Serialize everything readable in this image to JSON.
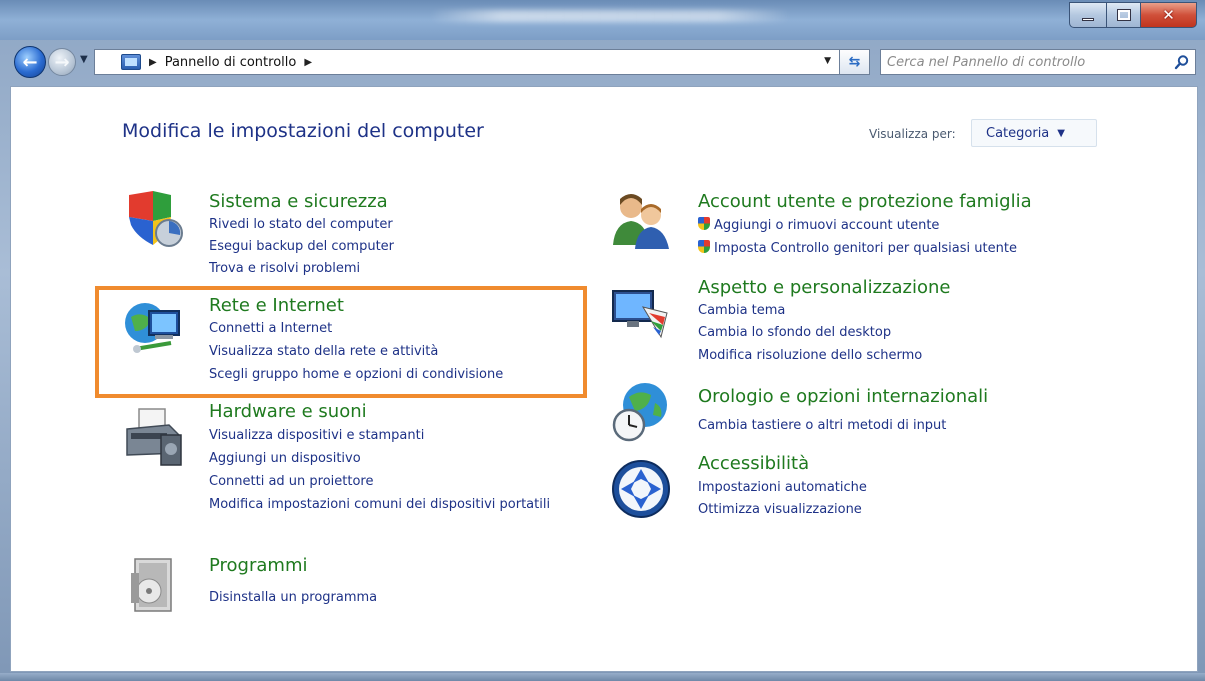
{
  "window": {
    "minimize_label": "minimize",
    "maximize_label": "maximize",
    "close_label": "close"
  },
  "nav": {
    "back_glyph": "←",
    "forward_glyph": "→",
    "breadcrumb": "Pannello di controllo",
    "search_placeholder": "Cerca nel Pannello di controllo"
  },
  "header": {
    "title": "Modifica le impostazioni del computer",
    "view_by_label": "Visualizza per:",
    "view_by_value": "Categoria"
  },
  "categories": [
    {
      "title": "Sistema e sicurezza",
      "icon": "shield-icon",
      "links": [
        "Rivedi lo stato del computer",
        "Esegui backup del computer",
        "Trova e risolvi problemi"
      ]
    },
    {
      "title": "Rete e Internet",
      "icon": "network-icon",
      "links": [
        "Connetti a Internet",
        "Visualizza stato della rete e attività",
        "Scegli gruppo home e opzioni di condivisione"
      ]
    },
    {
      "title": "Hardware e suoni",
      "icon": "printer-icon",
      "links": [
        "Visualizza dispositivi e stampanti",
        "Aggiungi un dispositivo",
        "Connetti ad un proiettore",
        "Modifica impostazioni comuni dei dispositivi portatili"
      ]
    },
    {
      "title": "Programmi",
      "icon": "programs-icon",
      "links": [
        "Disinstalla un programma"
      ]
    },
    {
      "title": "Account utente e protezione famiglia",
      "icon": "users-icon",
      "links": [
        "Aggiungi o rimuovi account utente",
        "Imposta Controllo genitori per qualsiasi utente"
      ]
    },
    {
      "title": "Aspetto e personalizzazione",
      "icon": "appearance-icon",
      "links": [
        "Cambia tema",
        "Cambia lo sfondo del desktop",
        "Modifica risoluzione dello schermo"
      ]
    },
    {
      "title": "Orologio e opzioni internazionali",
      "icon": "clock-globe-icon",
      "links": [
        "Cambia tastiere o altri metodi di input"
      ]
    },
    {
      "title": "Accessibilità",
      "icon": "accessibility-icon",
      "links": [
        "Impostazioni automatiche",
        "Ottimizza visualizzazione"
      ]
    }
  ],
  "colors": {
    "category_title": "#1f7a1f",
    "link": "#1e3287",
    "highlight": "#f08b2e"
  }
}
